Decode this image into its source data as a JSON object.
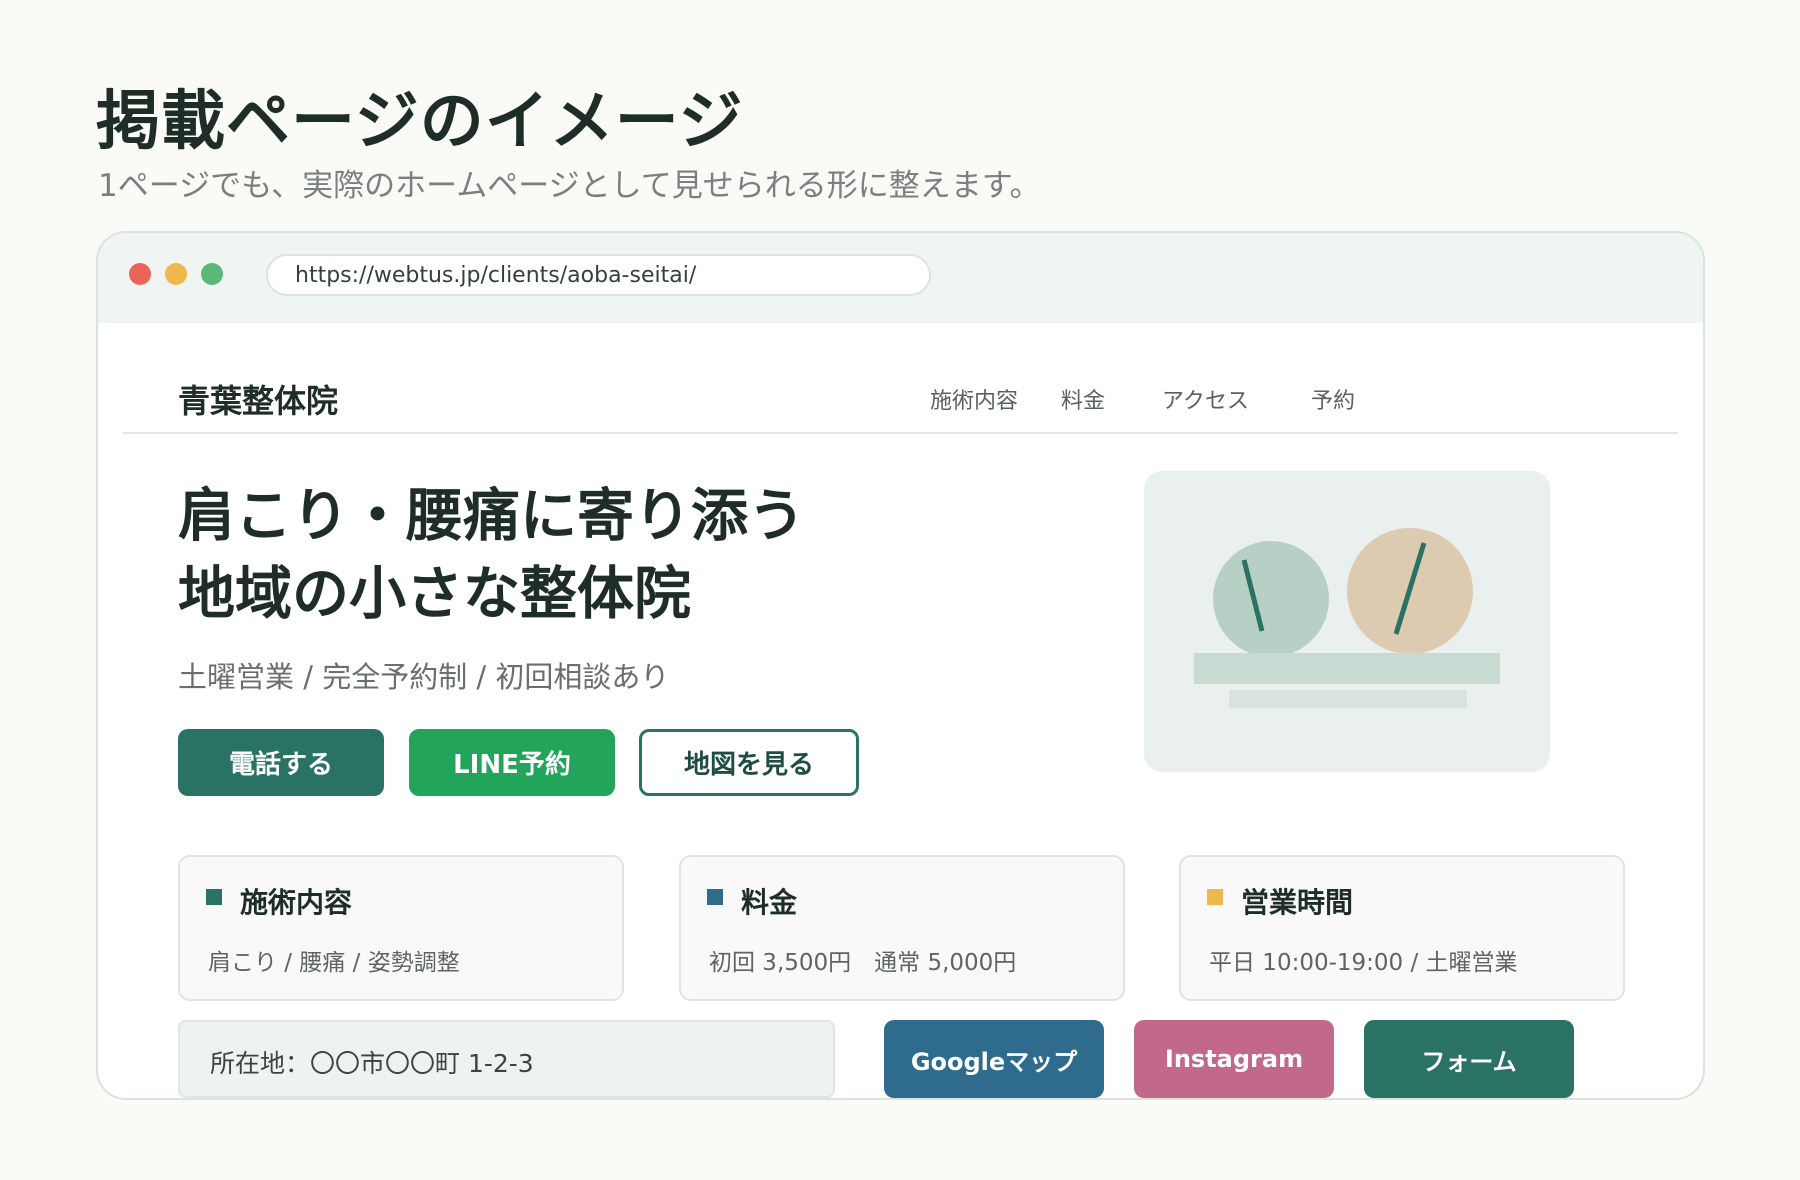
{
  "heading": "掲載ページのイメージ",
  "subheading": "1ページでも、実際のホームページとして見せられる形に整えます。",
  "browser": {
    "url": "https://webtus.jp/clients/aoba-seitai/"
  },
  "site": {
    "logo": "青葉整体院",
    "nav": [
      "施術内容",
      "料金",
      "アクセス",
      "予約"
    ],
    "hero": {
      "title_line1": "肩こり・腰痛に寄り添う",
      "title_line2": "地域の小さな整体院",
      "subtitle": "土曜営業 / 完全予約制 / 初回相談あり"
    },
    "buttons": {
      "call": "電話する",
      "line": "LINE予約",
      "map": "地図を見る"
    },
    "cards": [
      {
        "title": "施術内容",
        "body": "肩こり / 腰痛 / 姿勢調整",
        "color": "#2a7264"
      },
      {
        "title": "料金",
        "body": "初回 3,500円　通常 5,000円",
        "color": "#2e6b8c"
      },
      {
        "title": "営業時間",
        "body": "平日 10:00-19:00 / 土曜営業",
        "color": "#efb84c"
      }
    ],
    "address": "所在地：〇〇市〇〇町 1-2-3",
    "links": {
      "google": "Googleマップ",
      "instagram": "Instagram",
      "form": "フォーム"
    }
  },
  "colors": {
    "primary": "#2a7264",
    "line_green": "#22a45a",
    "google_blue": "#2e6b8c",
    "instagram_pink": "#c2698b",
    "accent_yellow": "#efb84c"
  }
}
